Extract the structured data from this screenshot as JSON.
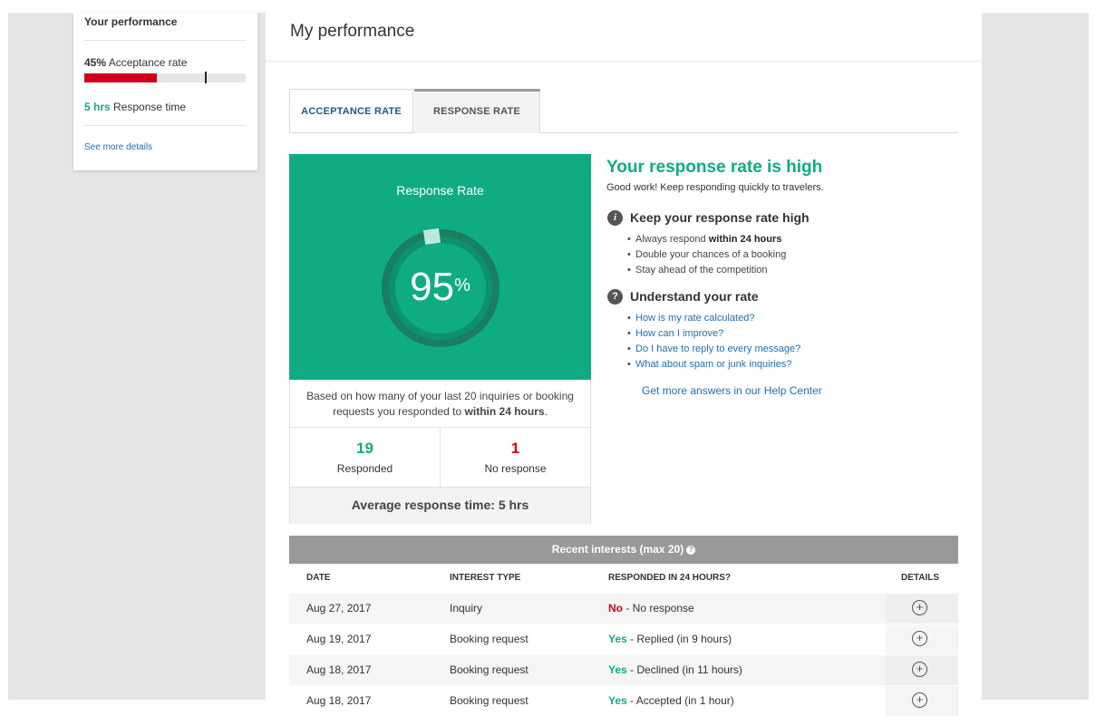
{
  "sidebar": {
    "title": "Your performance",
    "acceptance_value": "45%",
    "acceptance_label": "Acceptance rate",
    "acceptance_fraction": 0.45,
    "response_value": "5 hrs",
    "response_label": "Response time",
    "see_more": "See more details"
  },
  "page": {
    "title": "My performance"
  },
  "tabs": [
    {
      "label": "ACCEPTANCE RATE",
      "active": false
    },
    {
      "label": "RESPONSE RATE",
      "active": true
    }
  ],
  "rate_panel": {
    "title": "Response Rate",
    "percent": "95",
    "percent_symbol": "%",
    "based_on_prefix": "Based on how many of your last 20 inquiries or booking requests you responded to",
    "based_on_bold": "within 24 hours",
    "based_on_suffix": ".",
    "responded_count": "19",
    "responded_label": "Responded",
    "no_response_count": "1",
    "no_response_label": "No response",
    "average": "Average response time:  5 hrs"
  },
  "info": {
    "headline": "Your response rate is high",
    "subline": "Good work! Keep responding quickly to travelers.",
    "keep_title": "Keep your response rate high",
    "keep_bullets": [
      {
        "text": "Always respond",
        "bold": "within 24 hours"
      },
      {
        "text": "Double your chances of a booking",
        "bold": ""
      },
      {
        "text": "Stay ahead of the competition",
        "bold": ""
      }
    ],
    "understand_title": "Understand your rate",
    "understand_links": [
      "How is my rate calculated?",
      "How can I improve?",
      "Do I have to reply to every message?",
      "What about spam or junk inquiries?"
    ],
    "help_link": "Get more answers in our Help Center"
  },
  "table": {
    "title": "Recent interests (max 20)",
    "columns": [
      "DATE",
      "INTEREST TYPE",
      "RESPONDED IN 24 HOURS?",
      "DETAILS"
    ],
    "rows": [
      {
        "date": "Aug 27, 2017",
        "type": "Inquiry",
        "status": "No",
        "status_kind": "no",
        "detail": " - No response"
      },
      {
        "date": "Aug 19, 2017",
        "type": "Booking request",
        "status": "Yes",
        "status_kind": "yes",
        "detail": " - Replied (in 9 hours)"
      },
      {
        "date": "Aug 18, 2017",
        "type": "Booking request",
        "status": "Yes",
        "status_kind": "yes",
        "detail": " - Declined (in 11 hours)"
      },
      {
        "date": "Aug 18, 2017",
        "type": "Booking request",
        "status": "Yes",
        "status_kind": "yes",
        "detail": " - Accepted (in 1 hour)"
      }
    ]
  },
  "colors": {
    "accent_green": "#0fac84",
    "alert_red": "#d0021b",
    "link_blue": "#1f6fb0"
  },
  "icons": {
    "info": "info-icon",
    "question": "question-icon",
    "expand": "plus-circle-icon"
  }
}
